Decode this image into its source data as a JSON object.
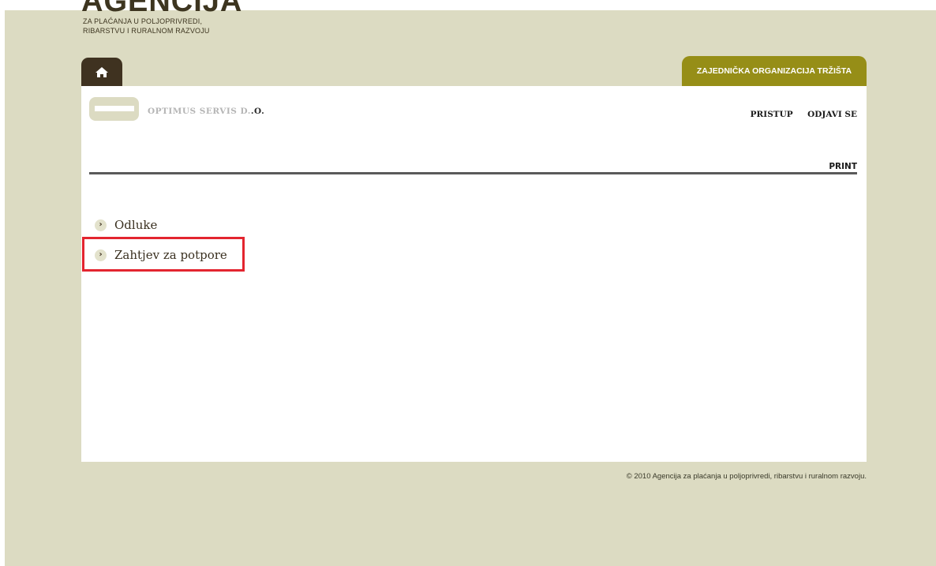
{
  "logo": {
    "word": "AGENCIJA",
    "line1": "ZA PLAĆANJA U POLJOPRIVREDI,",
    "line2": "RIBARSTVU I RURALNOM RAZVOJU"
  },
  "tabs": {
    "home_icon": "home-icon",
    "market": "ZAJEDNIČKA ORGANIZACIJA TRŽIŠTA"
  },
  "header": {
    "company_name_redacted": "OPTIMUS SERVIS D.",
    "company_name_suffix": ".O.",
    "links": [
      "PRISTUP",
      "ODJAVI SE"
    ],
    "print": "PRINT"
  },
  "menu": [
    {
      "label": "Odluke",
      "icon": "chevron-right-icon"
    },
    {
      "label": "Zahtjev za potpore",
      "icon": "chevron-right-icon",
      "highlighted": true
    }
  ],
  "footer": "© 2010 Agencija za plaćanja u poljoprivredi, ribarstvu i ruralnom razvoju.",
  "colors": {
    "background": "#dcdbc2",
    "home_tab": "#3f3220",
    "market_tab": "#968e17",
    "highlight": "#e3252f"
  }
}
